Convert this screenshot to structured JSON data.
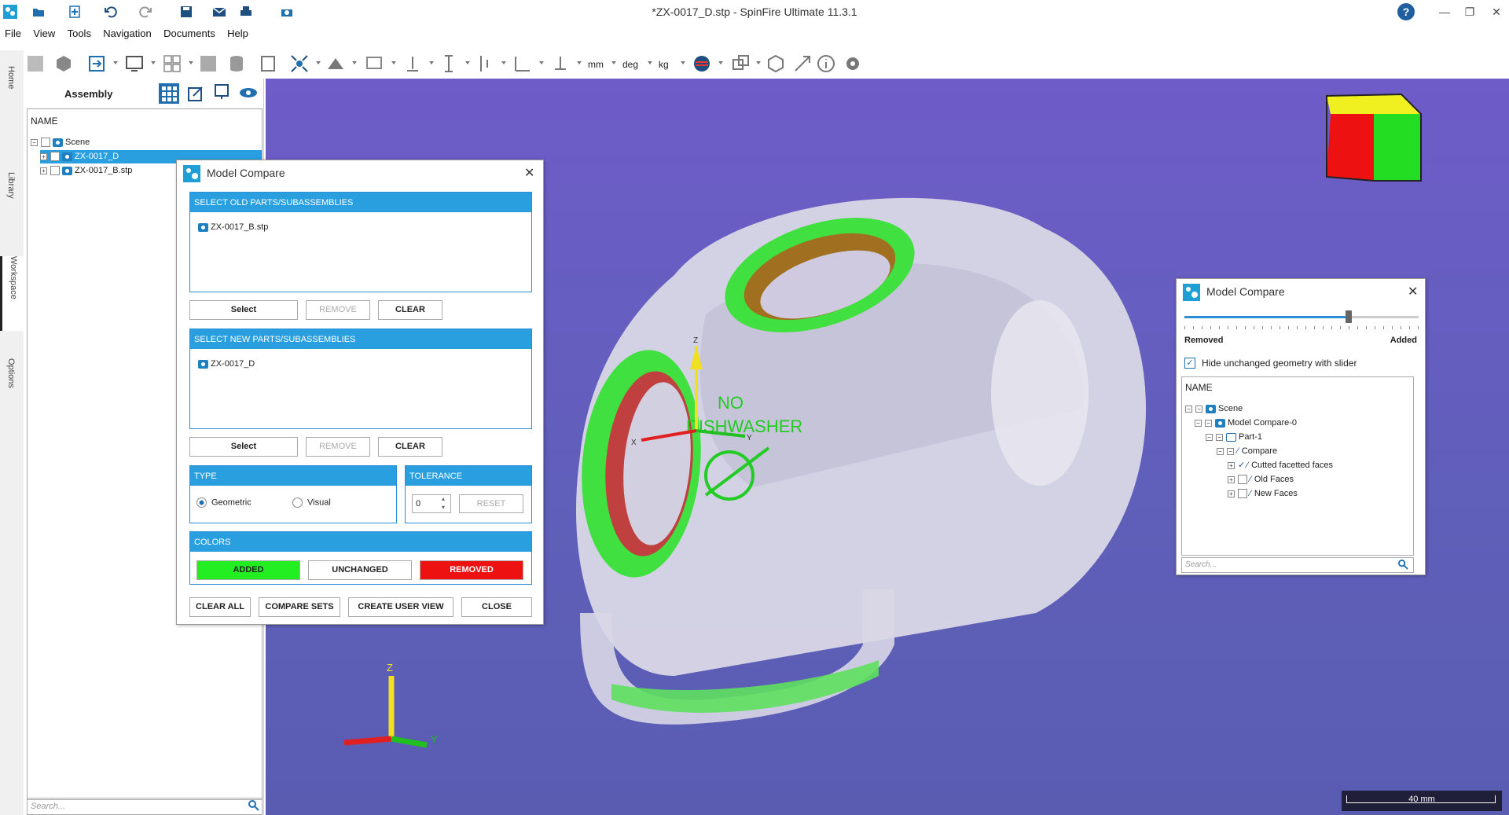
{
  "app": {
    "title": "*ZX-0017_D.stp - SpinFire Ultimate 11.3.1"
  },
  "menu": [
    "File",
    "View",
    "Tools",
    "Navigation",
    "Documents",
    "Help"
  ],
  "toolbar": {
    "units_length": "mm",
    "units_angle": "deg",
    "units_mass": "kg"
  },
  "vtabs": [
    "Home",
    "Library",
    "Workspace",
    "Options"
  ],
  "assembly": {
    "title": "Assembly",
    "column": "NAME",
    "tree": [
      {
        "label": "Scene",
        "level": 0
      },
      {
        "label": "ZX-0017_D",
        "level": 1,
        "selected": true
      },
      {
        "label": "ZX-0017_B.stp",
        "level": 1
      }
    ],
    "search_placeholder": "Search..."
  },
  "model_compare": {
    "title": "Model Compare",
    "old_header": "SELECT OLD PARTS/SUBASSEMBLIES",
    "old_item": "ZX-0017_B.stp",
    "new_header": "SELECT NEW PARTS/SUBASSEMBLIES",
    "new_item": "ZX-0017_D",
    "select_label": "Select",
    "remove_label": "REMOVE",
    "clear_label": "CLEAR",
    "type_header": "TYPE",
    "type_geometric": "Geometric",
    "type_visual": "Visual",
    "tolerance_header": "TOLERANCE",
    "tolerance_value": "0",
    "reset_label": "RESET",
    "colors_header": "COLORS",
    "added_label": "ADDED",
    "unchanged_label": "UNCHANGED",
    "removed_label": "REMOVED",
    "added_color": "#22ee22",
    "removed_color": "#ee1111",
    "clear_all_label": "CLEAR ALL",
    "compare_sets_label": "COMPARE SETS",
    "create_user_view_label": "CREATE USER VIEW",
    "close_label": "CLOSE"
  },
  "model_compare_slider": {
    "title": "Model Compare",
    "slider_position": 0.7,
    "left_label": "Removed",
    "right_label": "Added",
    "hide_label": "Hide unchanged geometry with slider",
    "column": "NAME",
    "tree": [
      {
        "label": "Scene",
        "level": 0
      },
      {
        "label": "Model Compare-0",
        "level": 1
      },
      {
        "label": "Part-1",
        "level": 2
      },
      {
        "label": "Compare",
        "level": 3
      },
      {
        "label": "Cutted facetted faces",
        "level": 4
      },
      {
        "label": "Old Faces",
        "level": 4
      },
      {
        "label": "New Faces",
        "level": 4
      }
    ],
    "search_placeholder": "Search..."
  },
  "viewport": {
    "part_text_1": "NO",
    "part_text_2": "DISHWASHER",
    "axis_z": "Z",
    "axis_y": "Y",
    "axis_x": "X",
    "scale_label": "40 mm"
  }
}
